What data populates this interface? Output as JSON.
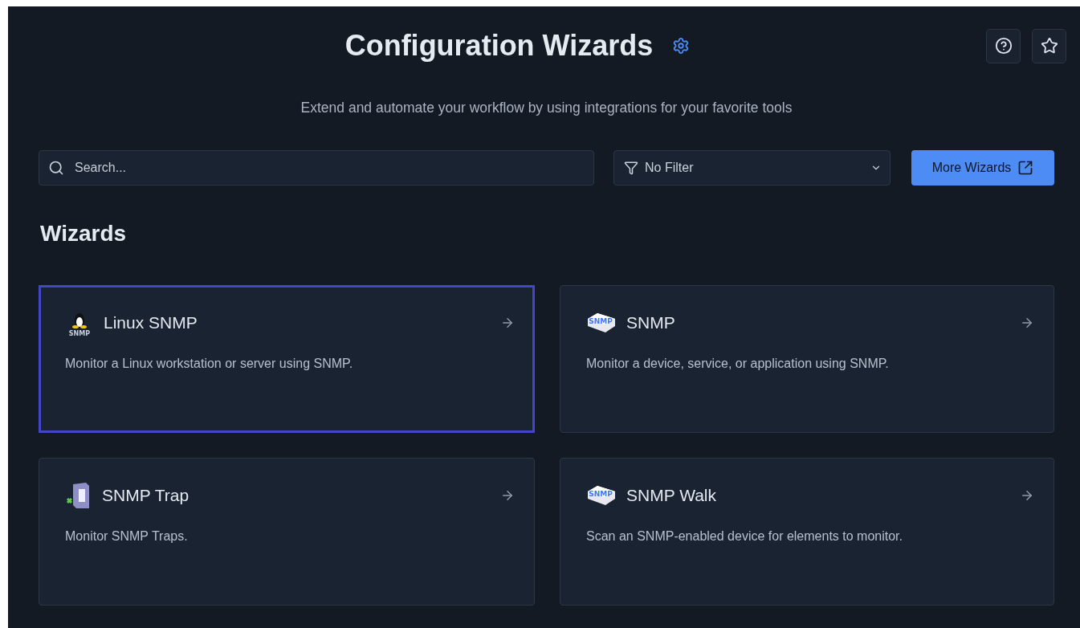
{
  "header": {
    "title": "Configuration Wizards",
    "subtitle": "Extend and automate your workflow by using integrations for your favorite tools"
  },
  "search": {
    "placeholder": "Search..."
  },
  "filter": {
    "value": "No Filter"
  },
  "more_button": {
    "label": "More Wizards"
  },
  "section_title": "Wizards",
  "cards": [
    {
      "title": "Linux SNMP",
      "description": "Monitor a Linux workstation or server using SNMP.",
      "kind": "penguin",
      "icon_text": "SNMP",
      "selected": true
    },
    {
      "title": "SNMP",
      "description": "Monitor a device, service, or application using SNMP.",
      "kind": "block",
      "icon_text": "SNMP",
      "selected": false
    },
    {
      "title": "SNMP Trap",
      "description": "Monitor SNMP Traps.",
      "kind": "server",
      "selected": false
    },
    {
      "title": "SNMP Walk",
      "description": "Scan an SNMP-enabled device for elements to monitor.",
      "kind": "block",
      "icon_text": "SNMP",
      "selected": false
    }
  ]
}
